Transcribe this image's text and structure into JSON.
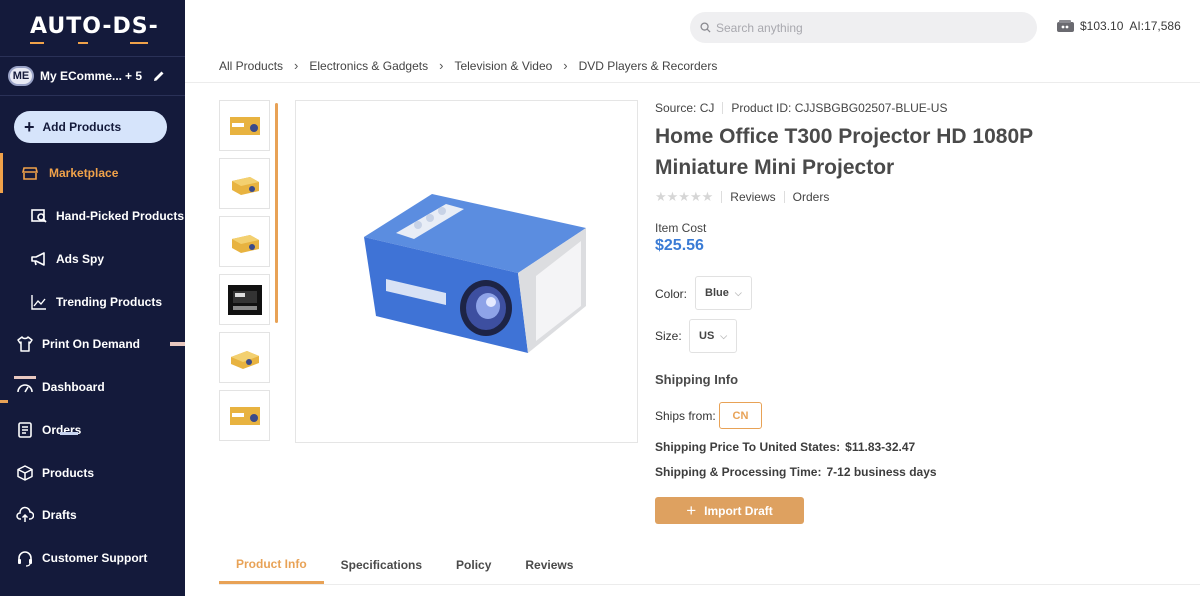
{
  "app": {
    "logo_text": "AUTO-DS-"
  },
  "colors": {
    "sidebar_bg": "#141a3b",
    "accent": "#e8a256",
    "price": "#3a7bd5",
    "add_btn_bg": "#d6e4fb"
  },
  "store": {
    "avatar": "ME",
    "name": "My EComme...",
    "count": "+ 5"
  },
  "sidebar": {
    "add_button": "Add Products",
    "items": [
      {
        "label": "Marketplace",
        "icon": "store-icon",
        "active": true
      },
      {
        "label": "Hand-Picked Products",
        "icon": "hand-picked-icon"
      },
      {
        "label": "Ads Spy",
        "icon": "megaphone-icon"
      },
      {
        "label": "Trending Products",
        "icon": "trend-chart-icon"
      },
      {
        "label": "Print On Demand",
        "icon": "shirt-icon"
      },
      {
        "label": "Dashboard",
        "icon": "gauge-icon"
      },
      {
        "label": "Orders",
        "icon": "clipboard-icon"
      },
      {
        "label": "Products",
        "icon": "box-icon"
      },
      {
        "label": "Drafts",
        "icon": "cloud-upload-icon"
      },
      {
        "label": "Customer Support",
        "icon": "headset-icon"
      }
    ]
  },
  "header": {
    "search_placeholder": "Search anything",
    "balance": "$103.10",
    "ai_credits": "AI:17,586"
  },
  "breadcrumb": [
    "All Products",
    "Electronics & Gadgets",
    "Television & Video",
    "DVD Players & Recorders"
  ],
  "product": {
    "source": "Source: CJ",
    "product_id": "Product ID: CJJSBGBG02507-BLUE-US",
    "title": "Home Office T300 Projector HD 1080P Miniature Mini Projector",
    "rating_stars": 0,
    "reviews_label": "Reviews",
    "orders_label": "Orders",
    "cost_label": "Item Cost",
    "price": "$25.56",
    "color_label": "Color:",
    "color_value": "Blue",
    "size_label": "Size:",
    "size_value": "US",
    "thumbnail_count": 6
  },
  "shipping": {
    "title": "Shipping Info",
    "ships_from_label": "Ships from:",
    "ships_from_value": "CN",
    "price_label": "Shipping Price To United States:",
    "price_value": "$11.83-32.47",
    "time_label": "Shipping & Processing Time:",
    "time_value": "7-12 business days"
  },
  "actions": {
    "import_draft": "Import Draft"
  },
  "tabs": [
    {
      "label": "Product Info",
      "active": true
    },
    {
      "label": "Specifications"
    },
    {
      "label": "Policy"
    },
    {
      "label": "Reviews"
    }
  ]
}
